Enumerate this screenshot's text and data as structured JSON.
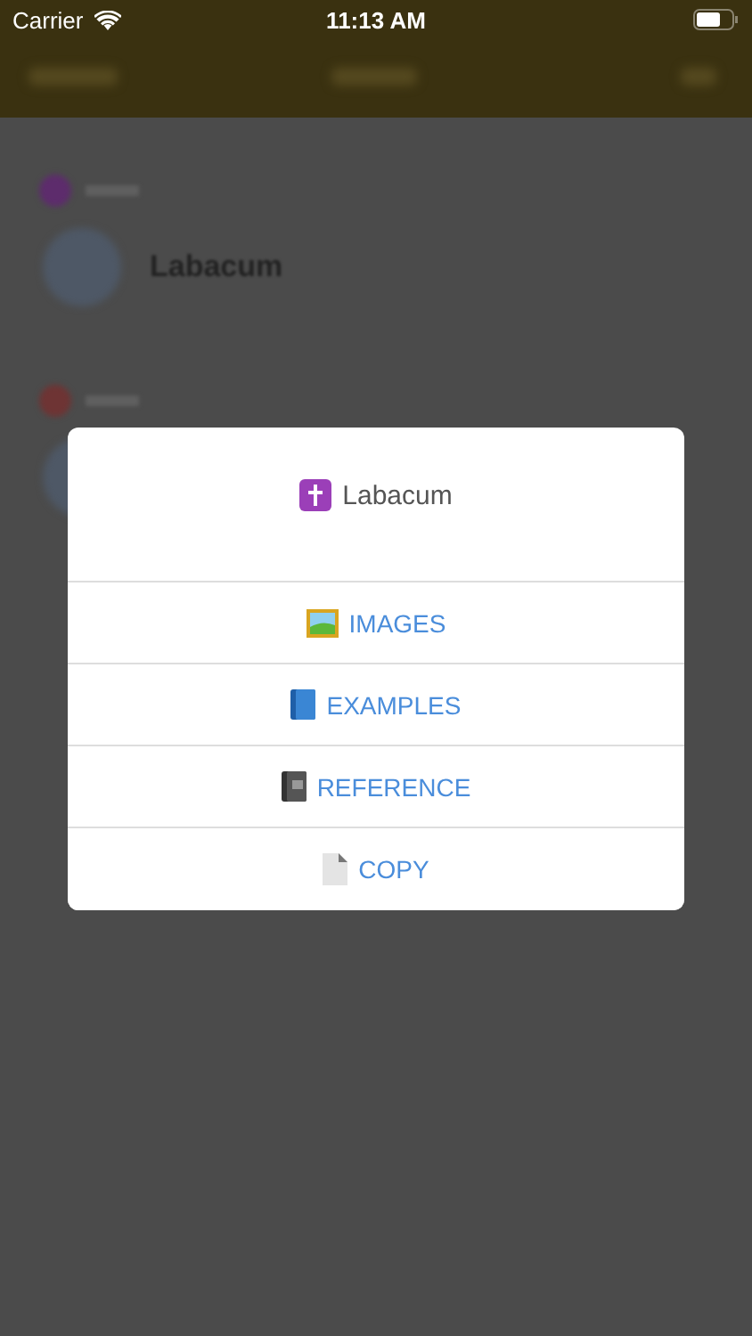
{
  "status_bar": {
    "carrier": "Carrier",
    "time": "11:13 AM"
  },
  "background_list": {
    "row_title": "Labacum"
  },
  "dialog": {
    "title": "Labacum",
    "options": [
      {
        "label": "IMAGES"
      },
      {
        "label": "EXAMPLES"
      },
      {
        "label": "REFERENCE"
      },
      {
        "label": "COPY"
      }
    ]
  }
}
